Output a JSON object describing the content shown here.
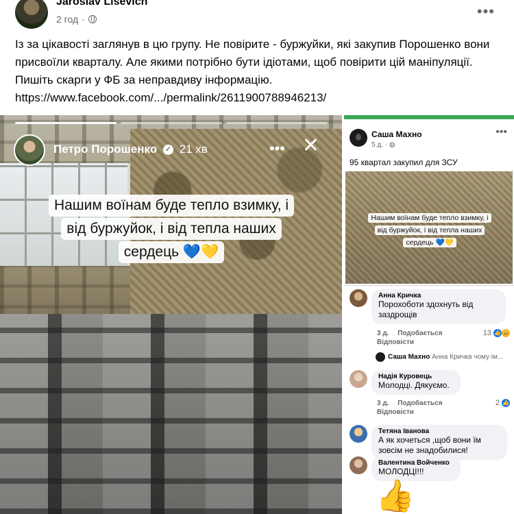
{
  "post": {
    "author": "Jaroslav Lisevich",
    "time": "2 год",
    "privacy_icon": "globe-icon",
    "more_icon": "more-horizontal-icon",
    "text": "Із за цікавості заглянув в цю групу. Не повірите - буржуйки, які закупив Порошенко вони присвоїли кварталу. Але якими потрібно бути ідіотами, щоб повірити цій маніпуляції. Пишіть скарги у ФБ за неправдиву інформацію.",
    "link": "https://www.facebook.com/.../permalink/2611900788946213/"
  },
  "story": {
    "author": "Петро Порошенко",
    "time": "21 хв",
    "caption_lines": [
      "Нашим воїнам буде тепло взимку, і",
      "від буржуйок, і від тепла наших",
      "сердець 💙💛"
    ],
    "more_icon": "more-horizontal-icon",
    "close_icon": "close-icon",
    "progress_segments": 3,
    "active_segments": 1
  },
  "screenshot": {
    "author": "Саша Махно",
    "time": "5 д.",
    "text": "95 квартал закупил для ЗСУ",
    "caption_lines": [
      "Нашим воїнам буде тепло взимку, і",
      "від буржуйок, і від тепла наших",
      "сердець 💙💛"
    ],
    "comments": [
      {
        "name": "Анна Кричка",
        "lines": [
          "Порохоботи здохнуть від",
          "заздрощів"
        ],
        "age": "3 д.",
        "like": "Подобається",
        "reply": "Відповісти",
        "reactions": "13",
        "reply_preview": {
          "name": "Саша Махно",
          "text": "Анна Кричка чому ім..."
        }
      },
      {
        "name": "Надія Куровець",
        "lines": [
          "Молодці. Дякуємо."
        ],
        "age": "3 д.",
        "like": "Подобається",
        "reply": "Відповісти",
        "reactions": "2"
      },
      {
        "name": "Тетяна Іванова",
        "lines": [
          "А як хочеться ,щоб вони їм",
          "зовсім не знадобилися!"
        ],
        "age": "",
        "like": "",
        "reply": "",
        "reactions": ""
      },
      {
        "name": "Валентина Войченко",
        "lines": [
          "МОЛОДЦІ!!!"
        ],
        "age": "",
        "like": "",
        "reply": "",
        "reactions": ""
      }
    ],
    "thumb_emoji": "👍"
  },
  "colors": {
    "accent_green": "#3aa655",
    "fb_blue": "#1877f2",
    "secondary_text": "#65676b"
  }
}
